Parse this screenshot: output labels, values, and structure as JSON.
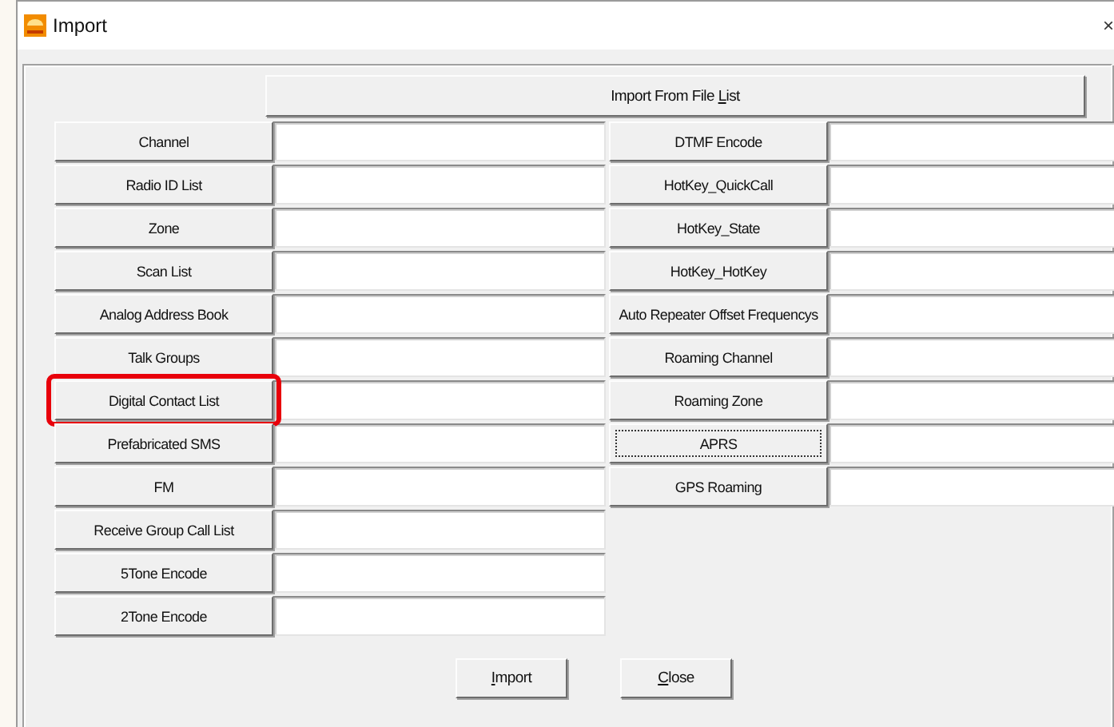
{
  "window": {
    "title": "Import",
    "close_glyph": "×"
  },
  "import_from_file_list": {
    "parts": [
      {
        "text": "Import From File ",
        "underline": false
      },
      {
        "text": "L",
        "underline": true
      },
      {
        "text": "ist",
        "underline": false
      }
    ]
  },
  "left_rows": [
    {
      "label": "Channel",
      "highlighted": false,
      "focused": false
    },
    {
      "label": "Radio ID List",
      "highlighted": false,
      "focused": false
    },
    {
      "label": "Zone",
      "highlighted": false,
      "focused": false
    },
    {
      "label": "Scan List",
      "highlighted": false,
      "focused": false
    },
    {
      "label": "Analog Address Book",
      "highlighted": false,
      "focused": false
    },
    {
      "label": "Talk Groups",
      "highlighted": false,
      "focused": false
    },
    {
      "label": "Digital Contact List",
      "highlighted": true,
      "focused": false
    },
    {
      "label": "Prefabricated SMS",
      "highlighted": false,
      "focused": false
    },
    {
      "label": "FM",
      "highlighted": false,
      "focused": false
    },
    {
      "label": "Receive Group Call List",
      "highlighted": false,
      "focused": false
    },
    {
      "label": "5Tone Encode",
      "highlighted": false,
      "focused": false
    },
    {
      "label": "2Tone Encode",
      "highlighted": false,
      "focused": false
    }
  ],
  "right_rows": [
    {
      "label": "DTMF Encode",
      "highlighted": false,
      "focused": false
    },
    {
      "label": "HotKey_QuickCall",
      "highlighted": false,
      "focused": false
    },
    {
      "label": "HotKey_State",
      "highlighted": false,
      "focused": false
    },
    {
      "label": "HotKey_HotKey",
      "highlighted": false,
      "focused": false
    },
    {
      "label": "Auto Repeater Offset Frequencys",
      "highlighted": false,
      "focused": false
    },
    {
      "label": "Roaming Channel",
      "highlighted": false,
      "focused": false
    },
    {
      "label": "Roaming Zone",
      "highlighted": false,
      "focused": false
    },
    {
      "label": "APRS",
      "highlighted": false,
      "focused": true
    },
    {
      "label": "GPS Roaming",
      "highlighted": false,
      "focused": false
    }
  ],
  "footer_buttons": [
    {
      "parts": [
        {
          "text": "I",
          "underline": true
        },
        {
          "text": "mport",
          "underline": false
        }
      ]
    },
    {
      "parts": [
        {
          "text": "C",
          "underline": true
        },
        {
          "text": "lose",
          "underline": false
        }
      ]
    }
  ]
}
